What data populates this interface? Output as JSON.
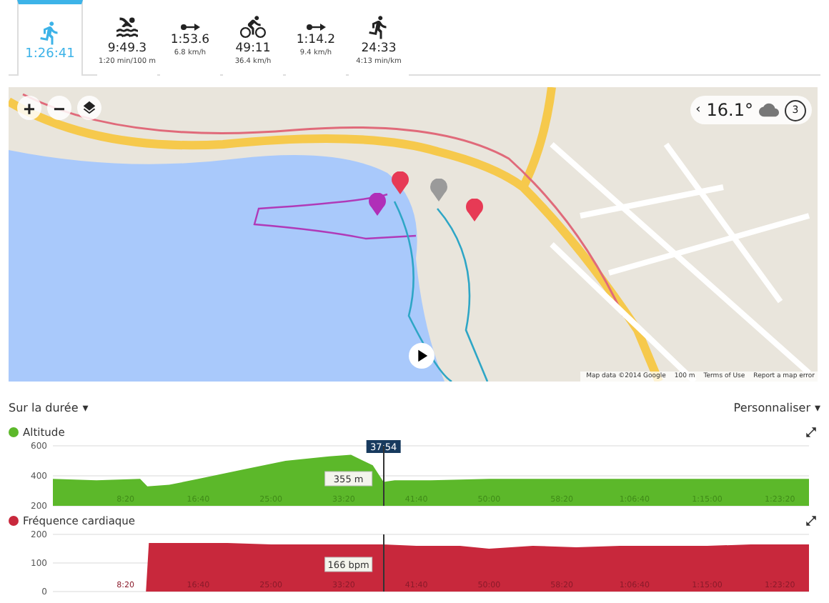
{
  "segments": [
    {
      "kind": "total",
      "time": "1:26:41",
      "selected": true
    },
    {
      "kind": "swim",
      "time": "9:49.3",
      "detail": "1:20 min/100 m",
      "selected": false
    },
    {
      "kind": "transition",
      "time": "1:53.6",
      "detail": "6.8 km/h",
      "selected": false
    },
    {
      "kind": "bike",
      "time": "49:11",
      "detail": "36.4 km/h",
      "selected": false
    },
    {
      "kind": "transition",
      "time": "1:14.2",
      "detail": "9.4 km/h",
      "selected": false
    },
    {
      "kind": "run",
      "time": "24:33",
      "detail": "4:13 min/km",
      "selected": false
    }
  ],
  "map": {
    "zoom_in": "+",
    "zoom_out": "−",
    "weather": {
      "back": "‹",
      "temperature": "16.1°",
      "badge": "3"
    },
    "attribution": [
      "Map data ©2014 Google",
      "100 m",
      "Terms of Use",
      "Report a map error"
    ]
  },
  "range_menu": {
    "label": "Sur la durée",
    "caret": "▾"
  },
  "customize_menu": {
    "label": "Personnaliser",
    "caret": "▾"
  },
  "charts": [
    {
      "cursor_label": "37:54",
      "value_label": "355 m",
      "chart_data": {
        "type": "area",
        "x": [
          0,
          300,
          600,
          650,
          800,
          1000,
          1300,
          1600,
          1900,
          2050,
          2200,
          2274,
          2350,
          2600,
          3000,
          3400,
          3800,
          4200,
          4600,
          5000,
          5200
        ],
        "series": [
          {
            "name": "Altitude",
            "color": "#5cb82a",
            "values": [
              380,
              370,
              380,
              330,
              340,
              380,
              440,
              500,
              530,
              540,
              470,
              360,
              370,
              370,
              380,
              380,
              380,
              380,
              380,
              380,
              380
            ]
          }
        ],
        "xlim": [
          0,
          5200
        ],
        "ylim": [
          200,
          600
        ],
        "yticks": [
          200,
          400,
          600
        ],
        "ref_lines": [
          {
            "axis": "x",
            "value": 2274
          }
        ],
        "xticks": [
          {
            "value": 500,
            "label": "8:20"
          },
          {
            "value": 1000,
            "label": "16:40"
          },
          {
            "value": 1500,
            "label": "25:00"
          },
          {
            "value": 2000,
            "label": "33:20"
          },
          {
            "value": 2500,
            "label": "41:40"
          },
          {
            "value": 3000,
            "label": "50:00"
          },
          {
            "value": 3500,
            "label": "58:20"
          },
          {
            "value": 4000,
            "label": "1:06:40"
          },
          {
            "value": 4500,
            "label": "1:15:00"
          },
          {
            "value": 5000,
            "label": "1:23:20"
          }
        ]
      }
    },
    {
      "value_label": "166 bpm",
      "chart_data": {
        "type": "area",
        "x": [
          0,
          640,
          660,
          900,
          1200,
          1500,
          1800,
          2100,
          2274,
          2500,
          2800,
          3000,
          3300,
          3600,
          3900,
          4200,
          4500,
          4800,
          5200
        ],
        "series": [
          {
            "name": "Fréquence cardiaque",
            "color": "#c8283c",
            "values": [
              0,
              0,
              170,
              170,
              170,
              165,
              165,
              165,
              165,
              160,
              160,
              150,
              160,
              155,
              160,
              160,
              160,
              165,
              165
            ]
          }
        ],
        "xlim": [
          0,
          5200
        ],
        "ylim": [
          0,
          200
        ],
        "yticks": [
          0,
          100,
          200
        ],
        "ref_lines": [
          {
            "axis": "x",
            "value": 2274
          }
        ],
        "xticks": [
          {
            "value": 500,
            "label": "8:20"
          },
          {
            "value": 1000,
            "label": "16:40"
          },
          {
            "value": 1500,
            "label": "25:00"
          },
          {
            "value": 2000,
            "label": "33:20"
          },
          {
            "value": 2500,
            "label": "41:40"
          },
          {
            "value": 3000,
            "label": "50:00"
          },
          {
            "value": 3500,
            "label": "58:20"
          },
          {
            "value": 4000,
            "label": "1:06:40"
          },
          {
            "value": 4500,
            "label": "1:15:00"
          },
          {
            "value": 5000,
            "label": "1:23:20"
          }
        ]
      }
    }
  ]
}
